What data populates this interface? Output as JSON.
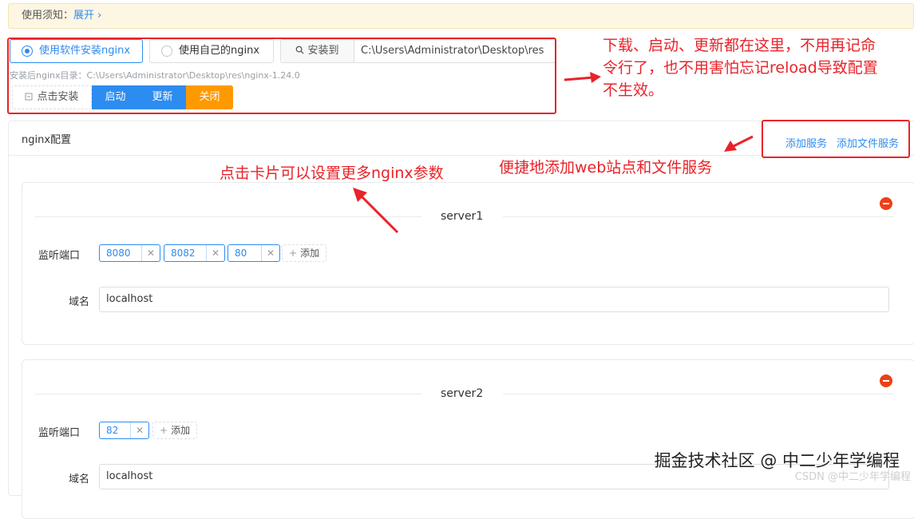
{
  "notice": {
    "label": "使用须知：",
    "expand": "展开 ›"
  },
  "mode": {
    "option_software": "使用软件安装nginx",
    "option_own": "使用自己的nginx",
    "selected": "software"
  },
  "install": {
    "addon_label": "安装到",
    "path": "C:\\Users\\Administrator\\Desktop\\res",
    "dir_text": "安装后nginx目录：C:\\Users\\Administrator\\Desktop\\res\\nginx-1.24.0"
  },
  "actions": {
    "install": "点击安装",
    "start": "启动",
    "update": "更新",
    "close": "关闭"
  },
  "config": {
    "title": "nginx配置",
    "add_service": "添加服务",
    "add_file_service": "添加文件服务"
  },
  "servers": [
    {
      "name": "server1",
      "ports_label": "监听端口",
      "ports": [
        "8080",
        "8082",
        "80"
      ],
      "add_label": "添加",
      "domain_label": "域名",
      "domain": "localhost"
    },
    {
      "name": "server2",
      "ports_label": "监听端口",
      "ports": [
        "82"
      ],
      "add_label": "添加",
      "domain_label": "域名",
      "domain": "localhost"
    }
  ],
  "annotations": {
    "top_line1": "下载、启动、更新都在这里，不用再记命",
    "top_line2": "令行了，也不用害怕忘记reload导致配置",
    "top_line3": "不生效。",
    "services": "便捷地添加web站点和文件服务",
    "card": "点击卡片可以设置更多nginx参数"
  },
  "watermark": {
    "main": "掘金技术社区 @ 中二少年学编程",
    "sub": "CSDN @中二少年学编程"
  },
  "colors": {
    "primary": "#2d8cf0",
    "warning": "#ff9900",
    "danger": "#ed4014",
    "annotation": "#e8232a"
  }
}
